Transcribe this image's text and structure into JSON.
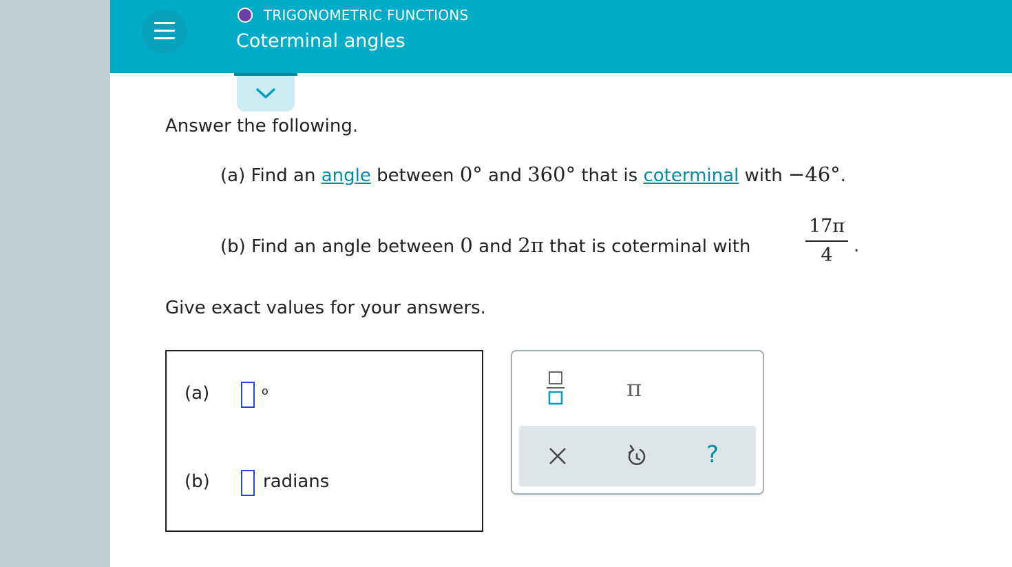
{
  "header": {
    "topic": "TRIGONOMETRIC FUNCTIONS",
    "title": "Coterminal angles"
  },
  "question": {
    "intro": "Answer the following.",
    "part_a": {
      "lead": "(a) Find an",
      "link1": "angle",
      "mid1": "between",
      "v1": "0°",
      "mid2": "and",
      "v2": "360°",
      "mid3": "that is",
      "link2": "coterminal",
      "mid4": "with",
      "v3": "−46°",
      "end": "."
    },
    "part_b": {
      "lead": "(b) Find an angle between",
      "v1": "0",
      "mid1": "and",
      "v2": "2π",
      "mid2": "that is coterminal with",
      "frac_num": "17π",
      "frac_den": "4",
      "end": "."
    },
    "instruction": "Give exact values for your answers."
  },
  "answers": {
    "a_label": "(a)",
    "a_unit": "o",
    "b_label": "(b)",
    "b_unit": "radians"
  },
  "toolbar": {
    "fraction": "fraction-icon",
    "pi_symbol": "π",
    "clear": "close-icon",
    "undo": "undo-icon",
    "help": "?"
  },
  "colors": {
    "header": "#00acc8",
    "link": "#008ca3",
    "input_border": "#2244e0"
  }
}
